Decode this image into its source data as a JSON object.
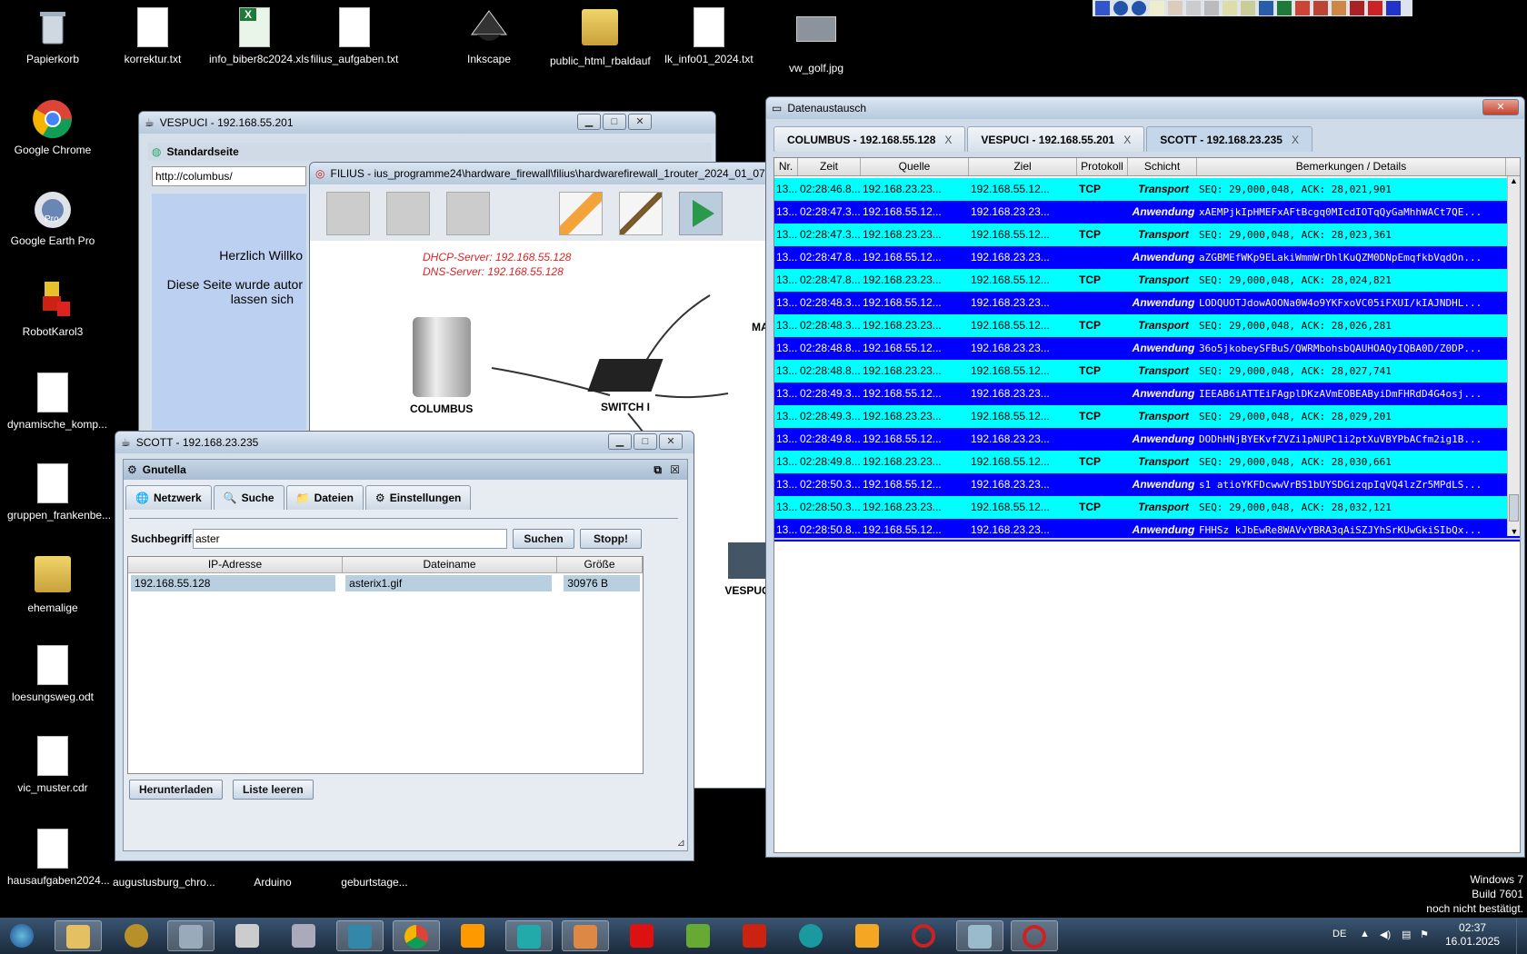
{
  "desktop_icons": [
    {
      "label": "Papierkorb"
    },
    {
      "label": "korrektur.txt"
    },
    {
      "label": "info_biber8c2024.xls"
    },
    {
      "label": "filius_aufgaben.txt"
    },
    {
      "label": "Inkscape"
    },
    {
      "label": "public_html_rbaldauf"
    },
    {
      "label": "lk_info01_2024.txt"
    },
    {
      "label": "vw_golf.jpg"
    },
    {
      "label": "Google Chrome"
    },
    {
      "label": "Google Earth Pro"
    },
    {
      "label": "RobotKarol3"
    },
    {
      "label": "dynamische_komp..."
    },
    {
      "label": "gruppen_frankenbe..."
    },
    {
      "label": "ehemalige"
    },
    {
      "label": "loesungsweg.odt"
    },
    {
      "label": "vic_muster.cdr"
    },
    {
      "label": "hausaufgaben2024..."
    },
    {
      "label": "augustusburg_chro..."
    },
    {
      "label": "Arduino"
    },
    {
      "label": "geburtstage..."
    }
  ],
  "google_earth_badge": "Pro",
  "vespuci": {
    "title": "VESPUCI - 192.168.55.201",
    "browser_title": "Standardseite",
    "url": "http://columbus/",
    "welcome": "Herzlich Willko",
    "line2": "Diese Seite wurde autor",
    "line3": "lassen sich"
  },
  "filius": {
    "title": "FILIUS - ius_programme24\\hardware_firewall\\filius\\hardwarefirewall_1router_2024_01_07",
    "dhcp": "DHCP-Server: 192.168.55.128",
    "dns": "DNS-Server: 192.168.55.128",
    "node_columbus": "COLUMBUS",
    "node_switch": "SWITCH I",
    "node_vespuci": "VESPUC",
    "node_ma": "MA"
  },
  "scott": {
    "title": "SCOTT - 192.168.23.235",
    "app_title": "Gnutella",
    "tabs": [
      {
        "label": "Netzwerk"
      },
      {
        "label": "Suche"
      },
      {
        "label": "Dateien"
      },
      {
        "label": "Einstellungen"
      }
    ],
    "search_label": "Suchbegriff:",
    "search_value": "aster",
    "search_btn": "Suchen",
    "stop_btn": "Stopp!",
    "columns": [
      "IP-Adresse",
      "Dateiname",
      "Größe"
    ],
    "rows": [
      {
        "ip": "192.168.55.128",
        "file": "asterix1.gif",
        "size": "30976 B"
      }
    ],
    "download_btn": "Herunterladen",
    "clear_btn": "Liste leeren"
  },
  "datenaustausch": {
    "title": "Datenaustausch",
    "tabs": [
      {
        "label": "COLUMBUS - 192.168.55.128",
        "close": "X"
      },
      {
        "label": "VESPUCI - 192.168.55.201",
        "close": "X"
      },
      {
        "label": "SCOTT - 192.168.23.235",
        "close": "X"
      }
    ],
    "columns": [
      "Nr.",
      "Zeit",
      "Quelle",
      "Ziel",
      "Protokoll",
      "Schicht",
      "Bemerkungen / Details"
    ],
    "rows": [
      {
        "nr": "13...",
        "zeit": "02:28:46.8...",
        "quelle": "192.168.23.23...",
        "ziel": "192.168.55.12...",
        "proto": "TCP",
        "schicht": "Transport",
        "details": "SEQ: 29,000,048, ACK: 28,021,901",
        "kind": "t"
      },
      {
        "nr": "13...",
        "zeit": "02:28:47.3...",
        "quelle": "192.168.55.12...",
        "ziel": "192.168.23.23...",
        "proto": "",
        "schicht": "Anwendung",
        "details": "xAEMPjkIpHMEFxAFtBcgq0MIcdIOTqQyGaMhhWACt7QE...",
        "kind": "a"
      },
      {
        "nr": "13...",
        "zeit": "02:28:47.3...",
        "quelle": "192.168.23.23...",
        "ziel": "192.168.55.12...",
        "proto": "TCP",
        "schicht": "Transport",
        "details": "SEQ: 29,000,048, ACK: 28,023,361",
        "kind": "t"
      },
      {
        "nr": "13...",
        "zeit": "02:28:47.8...",
        "quelle": "192.168.55.12...",
        "ziel": "192.168.23.23...",
        "proto": "",
        "schicht": "Anwendung",
        "details": "aZGBMEfWKp9ELakiWmmWrDhlKuQZM0DNpEmqfkbVqdOn...",
        "kind": "a"
      },
      {
        "nr": "13...",
        "zeit": "02:28:47.8...",
        "quelle": "192.168.23.23...",
        "ziel": "192.168.55.12...",
        "proto": "TCP",
        "schicht": "Transport",
        "details": "SEQ: 29,000,048, ACK: 28,024,821",
        "kind": "t"
      },
      {
        "nr": "13...",
        "zeit": "02:28:48.3...",
        "quelle": "192.168.55.12...",
        "ziel": "192.168.23.23...",
        "proto": "",
        "schicht": "Anwendung",
        "details": "LODQUOTJdowAOONa0W4o9YKFxoVC05iFXUI/kIAJNDHL...",
        "kind": "a"
      },
      {
        "nr": "13...",
        "zeit": "02:28:48.3...",
        "quelle": "192.168.23.23...",
        "ziel": "192.168.55.12...",
        "proto": "TCP",
        "schicht": "Transport",
        "details": "SEQ: 29,000,048, ACK: 28,026,281",
        "kind": "t"
      },
      {
        "nr": "13...",
        "zeit": "02:28:48.8...",
        "quelle": "192.168.55.12...",
        "ziel": "192.168.23.23...",
        "proto": "",
        "schicht": "Anwendung",
        "details": "36o5jkobeySFBuS/QWRMbohsbQAUHOAQyIQBA0D/Z0DP...",
        "kind": "a"
      },
      {
        "nr": "13...",
        "zeit": "02:28:48.8...",
        "quelle": "192.168.23.23...",
        "ziel": "192.168.55.12...",
        "proto": "TCP",
        "schicht": "Transport",
        "details": "SEQ: 29,000,048, ACK: 28,027,741",
        "kind": "t"
      },
      {
        "nr": "13...",
        "zeit": "02:28:49.3...",
        "quelle": "192.168.55.12...",
        "ziel": "192.168.23.23...",
        "proto": "",
        "schicht": "Anwendung",
        "details": "IEEAB6iATTEiFAgplDKzAVmEOBEAByiDmFHRdD4G4osj...",
        "kind": "a"
      },
      {
        "nr": "13...",
        "zeit": "02:28:49.3...",
        "quelle": "192.168.23.23...",
        "ziel": "192.168.55.12...",
        "proto": "TCP",
        "schicht": "Transport",
        "details": "SEQ: 29,000,048, ACK: 28,029,201",
        "kind": "t"
      },
      {
        "nr": "13...",
        "zeit": "02:28:49.8...",
        "quelle": "192.168.55.12...",
        "ziel": "192.168.23.23...",
        "proto": "",
        "schicht": "Anwendung",
        "details": "DODhHNjBYEKvfZVZi1pNUPC1i2ptXuVBYPbACfm2ig1B...",
        "kind": "a"
      },
      {
        "nr": "13...",
        "zeit": "02:28:49.8...",
        "quelle": "192.168.23.23...",
        "ziel": "192.168.55.12...",
        "proto": "TCP",
        "schicht": "Transport",
        "details": "SEQ: 29,000,048, ACK: 28,030,661",
        "kind": "t"
      },
      {
        "nr": "13...",
        "zeit": "02:28:50.3...",
        "quelle": "192.168.55.12...",
        "ziel": "192.168.23.23...",
        "proto": "",
        "schicht": "Anwendung",
        "details": "s1 atioYKFDcwwVrBS1bUYSDGizqpIqVQ4lzZr5MPdLS...",
        "kind": "a"
      },
      {
        "nr": "13...",
        "zeit": "02:28:50.3...",
        "quelle": "192.168.23.23...",
        "ziel": "192.168.55.12...",
        "proto": "TCP",
        "schicht": "Transport",
        "details": "SEQ: 29,000,048, ACK: 28,032,121",
        "kind": "t"
      },
      {
        "nr": "13...",
        "zeit": "02:28:50.8...",
        "quelle": "192.168.55.12...",
        "ziel": "192.168.23.23...",
        "proto": "",
        "schicht": "Anwendung",
        "details": "FHHSz kJbEwRe8WAVvYBRA3qAiSZJYhSrKUwGkiSIbQx...",
        "kind": "a"
      }
    ]
  },
  "watermark": {
    "line1": "Windows 7",
    "line2": "Build 7601",
    "line3": "noch nicht bestätigt."
  },
  "tray": {
    "lang": "DE",
    "time": "02:37",
    "date": "16.01.2025"
  },
  "colors": {
    "transport_row": "#00ffff",
    "anwendung_row": "#0000ff",
    "desktop": "#000000"
  }
}
